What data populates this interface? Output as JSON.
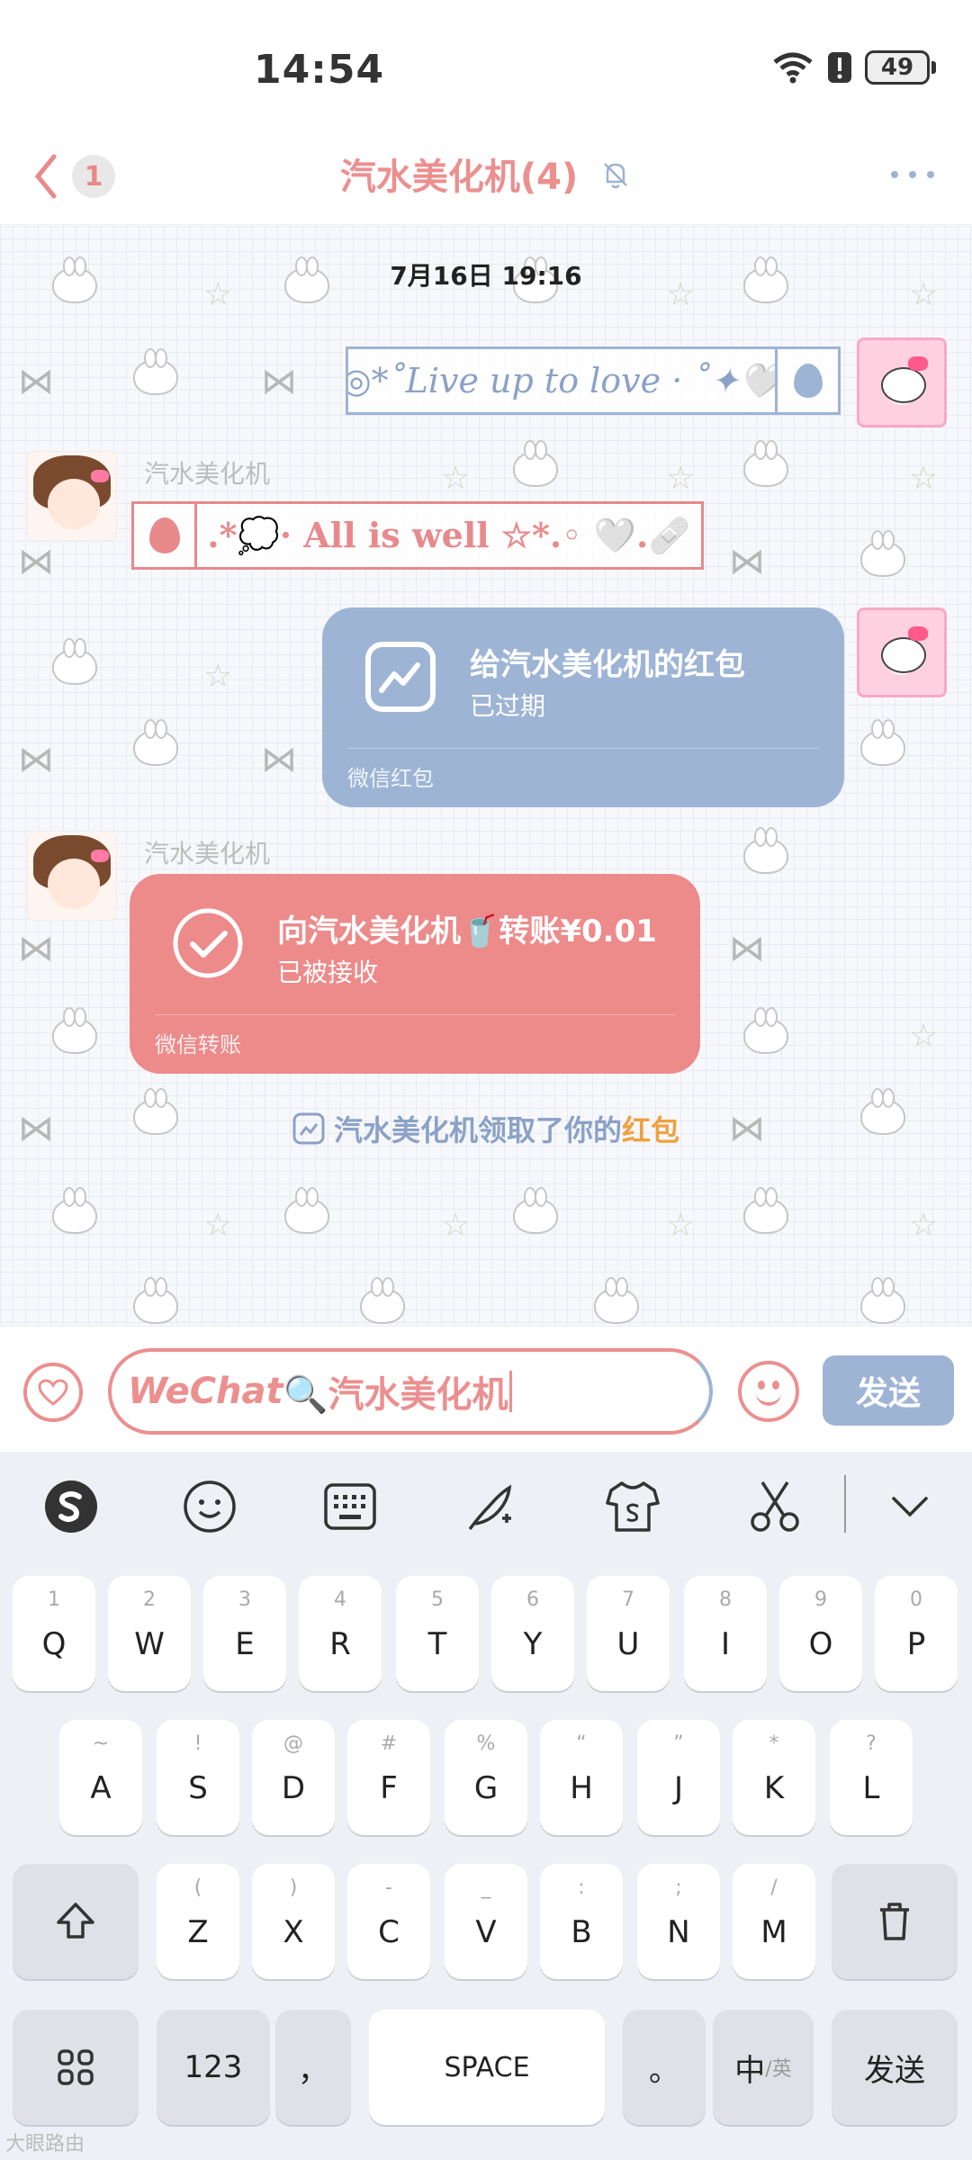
{
  "status": {
    "time": "14:54",
    "battery": "49"
  },
  "header": {
    "back_count": "1",
    "title": "汽水美化机(4)"
  },
  "chat": {
    "timestamp": "7月16日 19:16",
    "msg1": {
      "text": "◎*˚Live up to love · ˚✦🤍"
    },
    "msg2": {
      "sender": "汽水美化机",
      "text": ".*💭· All is well ☆*.◦  🤍.🩹"
    },
    "red_packet": {
      "title": "给汽水美化机的红包",
      "status": "已过期",
      "footer": "微信红包"
    },
    "transfer": {
      "sender": "汽水美化机",
      "title": "向汽水美化机🥤转账¥0.01",
      "status": "已被接收",
      "footer": "微信转账"
    },
    "system": {
      "prefix": "汽水美化机领取了你的",
      "highlight": "红包"
    }
  },
  "input": {
    "value_italic": "WeChat",
    "value_rest": "🔍汽水美化机",
    "send_label": "发送"
  },
  "keyboard": {
    "row1": [
      {
        "hint": "1",
        "key": "Q"
      },
      {
        "hint": "2",
        "key": "W"
      },
      {
        "hint": "3",
        "key": "E"
      },
      {
        "hint": "4",
        "key": "R"
      },
      {
        "hint": "5",
        "key": "T"
      },
      {
        "hint": "6",
        "key": "Y"
      },
      {
        "hint": "7",
        "key": "U"
      },
      {
        "hint": "8",
        "key": "I"
      },
      {
        "hint": "9",
        "key": "O"
      },
      {
        "hint": "0",
        "key": "P"
      }
    ],
    "row2": [
      {
        "hint": "~",
        "key": "A"
      },
      {
        "hint": "!",
        "key": "S"
      },
      {
        "hint": "@",
        "key": "D"
      },
      {
        "hint": "#",
        "key": "F"
      },
      {
        "hint": "%",
        "key": "G"
      },
      {
        "hint": "“",
        "key": "H"
      },
      {
        "hint": "”",
        "key": "J"
      },
      {
        "hint": "*",
        "key": "K"
      },
      {
        "hint": "?",
        "key": "L"
      }
    ],
    "row3": [
      {
        "hint": "(",
        "key": "Z"
      },
      {
        "hint": ")",
        "key": "X"
      },
      {
        "hint": "-",
        "key": "C"
      },
      {
        "hint": "_",
        "key": "V"
      },
      {
        "hint": ":",
        "key": "B"
      },
      {
        "hint": ";",
        "key": "N"
      },
      {
        "hint": "/",
        "key": "M"
      }
    ],
    "num_key": "123",
    "comma_key": "，",
    "space_key": "SPACE",
    "period_key": "。",
    "lang_key_main": "中",
    "lang_key_sub": "/英",
    "send_key": "发送"
  },
  "watermark": "大眼路由"
}
